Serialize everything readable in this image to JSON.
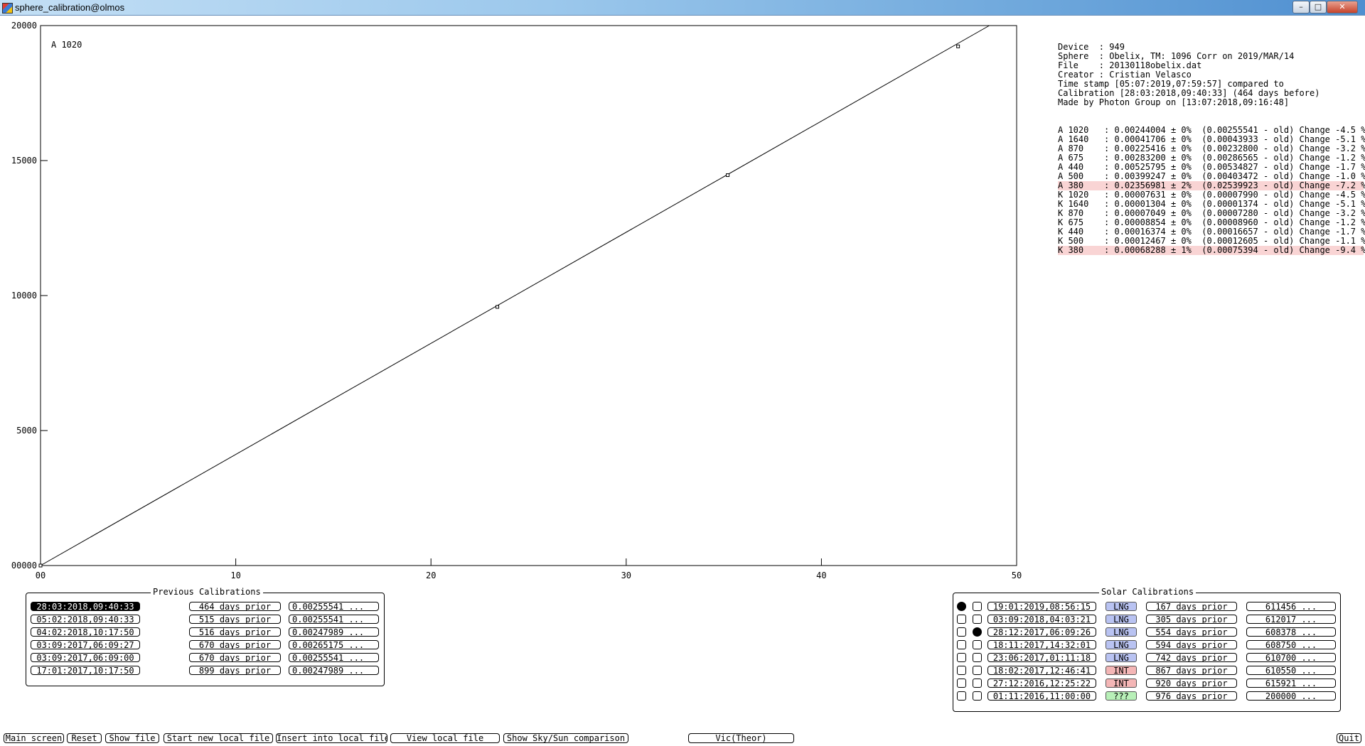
{
  "window": {
    "title": "sphere_calibration@olmos",
    "minimize": "–",
    "maximize": "□",
    "close": "✕"
  },
  "chart_data": {
    "type": "scatter",
    "title": "",
    "series_label": "A 1020",
    "xlim": [
      0,
      50
    ],
    "ylim": [
      0,
      20000
    ],
    "x_ticks": [
      0,
      10,
      20,
      30,
      40,
      50
    ],
    "x_tick_labels": [
      "00",
      "10",
      "20",
      "30",
      "40",
      "50"
    ],
    "y_ticks": [
      0,
      5000,
      10000,
      15000,
      20000
    ],
    "y_tick_labels": [
      "00000",
      "5000",
      "10000",
      "15000",
      "20000"
    ],
    "points": [
      {
        "x": 0,
        "y": 0
      },
      {
        "x": 23.4,
        "y": 9580
      },
      {
        "x": 35.2,
        "y": 14460
      },
      {
        "x": 47.0,
        "y": 19230
      }
    ],
    "fit_line": {
      "x": [
        0,
        48.6
      ],
      "y": [
        0,
        20000
      ]
    }
  },
  "info": {
    "lines": [
      "Device  : 949",
      "Sphere  : Obelix, TM: 1096 Corr on 2019/MAR/14",
      "File    : 20130118obelix.dat",
      "Creator : Cristian Velasco",
      "Time stamp [05:07:2019,07:59:57] compared to",
      "Calibration [28:03:2018,09:40:33] (464 days before)",
      "Made by Photon Group on [13:07:2018,09:16:48]"
    ],
    "calibrations": [
      {
        "text": "A 1020   : 0.00244004 ± 0%  (0.00255541 - old) Change -4.5 %",
        "warn": false
      },
      {
        "text": "A 1640   : 0.00041706 ± 0%  (0.00043933 - old) Change -5.1 %",
        "warn": false
      },
      {
        "text": "A 870    : 0.00225416 ± 0%  (0.00232800 - old) Change -3.2 %",
        "warn": false
      },
      {
        "text": "A 675    : 0.00283200 ± 0%  (0.00286565 - old) Change -1.2 %",
        "warn": false
      },
      {
        "text": "A 440    : 0.00525795 ± 0%  (0.00534827 - old) Change -1.7 %",
        "warn": false
      },
      {
        "text": "A 500    : 0.00399247 ± 0%  (0.00403472 - old) Change -1.0 %",
        "warn": false
      },
      {
        "text": "A 380    : 0.02356981 ± 2%  (0.02539923 - old) Change -7.2 %",
        "warn": true
      },
      {
        "text": "K 1020   : 0.00007631 ± 0%  (0.00007990 - old) Change -4.5 %",
        "warn": false
      },
      {
        "text": "K 1640   : 0.00001304 ± 0%  (0.00001374 - old) Change -5.1 %",
        "warn": false
      },
      {
        "text": "K 870    : 0.00007049 ± 0%  (0.00007280 - old) Change -3.2 %",
        "warn": false
      },
      {
        "text": "K 675    : 0.00008854 ± 0%  (0.00008960 - old) Change -1.2 %",
        "warn": false
      },
      {
        "text": "K 440    : 0.00016374 ± 0%  (0.00016657 - old) Change -1.7 %",
        "warn": false
      },
      {
        "text": "K 500    : 0.00012467 ± 0%  (0.00012605 - old) Change -1.1 %",
        "warn": false
      },
      {
        "text": "K 380    : 0.00068288 ± 1%  (0.00075394 - old) Change -9.4 %",
        "warn": true
      }
    ]
  },
  "previous_calibrations": {
    "title": "Previous Calibrations",
    "rows": [
      {
        "date": "28:03:2018,09:40:33",
        "prior": "464 days prior",
        "value": "0.00255541 ...",
        "selected": true
      },
      {
        "date": "05:02:2018,09:40:33",
        "prior": "515 days prior",
        "value": "0.00255541 ...",
        "selected": false
      },
      {
        "date": "04:02:2018,10:17:50",
        "prior": "516 days prior",
        "value": "0.00247989 ...",
        "selected": false
      },
      {
        "date": "03:09:2017,06:09:27",
        "prior": "670 days prior",
        "value": "0.00265175 ...",
        "selected": false
      },
      {
        "date": "03:09:2017,06:09:00",
        "prior": "670 days prior",
        "value": "0.00255541 ...",
        "selected": false
      },
      {
        "date": "17:01:2017,10:17:50",
        "prior": "899 days prior",
        "value": "0.00247989 ...",
        "selected": false
      }
    ]
  },
  "solar_calibrations": {
    "title": "Solar Calibrations",
    "rows": [
      {
        "chk1": true,
        "chk2": false,
        "date": "19:01:2019,08:56:15",
        "type": "LNG",
        "type_color": "#b9c3f2",
        "prior": "167 days prior",
        "value": "611456 ..."
      },
      {
        "chk1": false,
        "chk2": false,
        "date": "03:09:2018,04:03:21",
        "type": "LNG",
        "type_color": "#b9c3f2",
        "prior": "305 days prior",
        "value": "612017 ..."
      },
      {
        "chk1": false,
        "chk2": true,
        "date": "28:12:2017,06:09:26",
        "type": "LNG",
        "type_color": "#b9c3f2",
        "prior": "554 days prior",
        "value": "608378 ..."
      },
      {
        "chk1": false,
        "chk2": false,
        "date": "18:11:2017,14:32:01",
        "type": "LNG",
        "type_color": "#b9c3f2",
        "prior": "594 days prior",
        "value": "608750 ..."
      },
      {
        "chk1": false,
        "chk2": false,
        "date": "23:06:2017,01:11:18",
        "type": "LNG",
        "type_color": "#b9c3f2",
        "prior": "742 days prior",
        "value": "610700 ..."
      },
      {
        "chk1": false,
        "chk2": false,
        "date": "18:02:2017,12:46:41",
        "type": "INT",
        "type_color": "#f4b6b6",
        "prior": "867 days prior",
        "value": "610550 ..."
      },
      {
        "chk1": false,
        "chk2": false,
        "date": "27:12:2016,12:25:22",
        "type": "INT",
        "type_color": "#f4b6b6",
        "prior": "920 days prior",
        "value": "615921 ..."
      },
      {
        "chk1": false,
        "chk2": false,
        "date": "01:11:2016,11:00:00",
        "type": "???",
        "type_color": "#b8f0b8",
        "prior": "976 days prior",
        "value": "200000 ..."
      }
    ]
  },
  "toolbar": {
    "main_screen": "Main screen",
    "reset": "Reset",
    "show_file": "Show file",
    "start_new_local_file": "Start new local file",
    "insert_into_local_file": "Insert into local file",
    "view_local_file": "View local file",
    "show_sky_sun": "Show Sky/Sun comparison",
    "vic_theor": "Vic(Theor)",
    "quit": "Quit"
  }
}
